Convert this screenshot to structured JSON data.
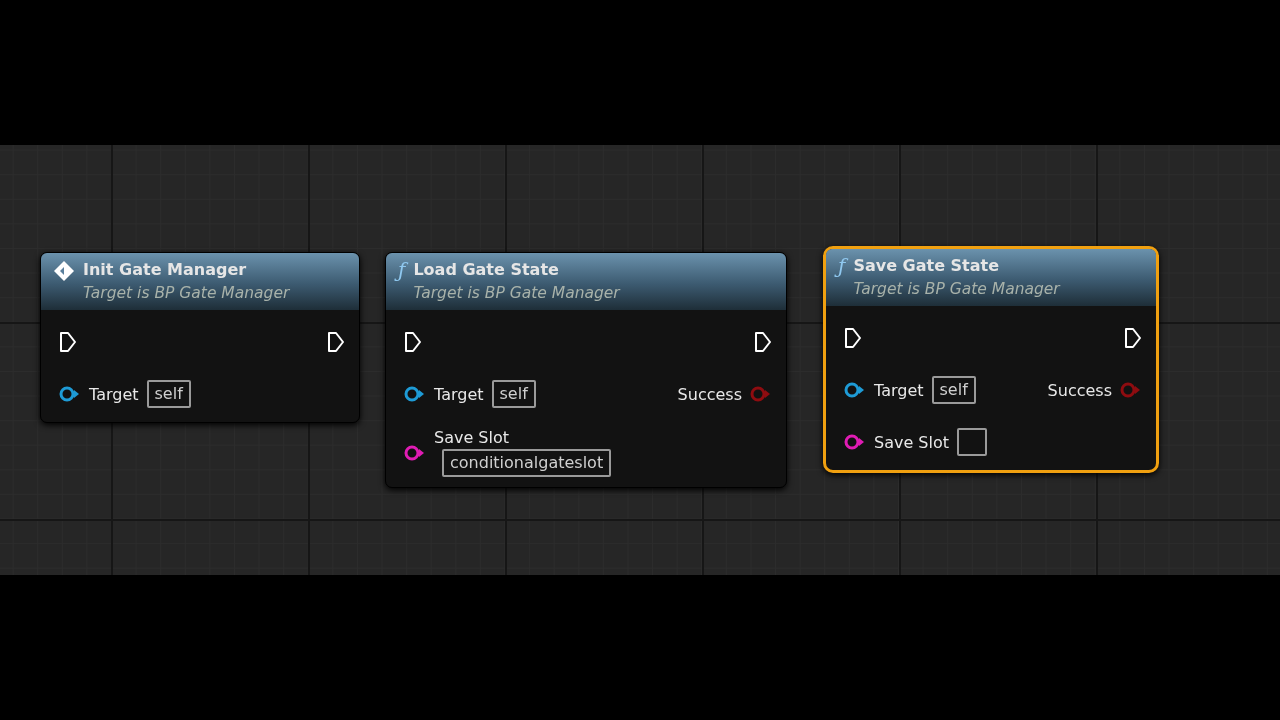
{
  "nodes": [
    {
      "kind": "event",
      "title": "Init Gate Manager",
      "subtitle": "Target is BP Gate Manager",
      "selected": false,
      "inputs": [
        {
          "kind": "exec"
        },
        {
          "kind": "object",
          "label": "Target",
          "field": true,
          "value": "self"
        }
      ],
      "outputs": [
        {
          "kind": "exec"
        }
      ]
    },
    {
      "kind": "function",
      "icon_glyph": "ƒ",
      "title": "Load Gate State",
      "subtitle": "Target is BP Gate Manager",
      "selected": false,
      "inputs": [
        {
          "kind": "exec"
        },
        {
          "kind": "object",
          "label": "Target",
          "field": true,
          "value": "self"
        },
        {
          "kind": "string",
          "label": "Save Slot",
          "field": true,
          "value": "conditionalgateslot",
          "value_below": true
        }
      ],
      "outputs": [
        {
          "kind": "exec"
        },
        {
          "kind": "bool",
          "label": "Success"
        }
      ]
    },
    {
      "kind": "function",
      "icon_glyph": "ƒ",
      "title": "Save Gate State",
      "subtitle": "Target is BP Gate Manager",
      "selected": true,
      "inputs": [
        {
          "kind": "exec"
        },
        {
          "kind": "object",
          "label": "Target",
          "field": true,
          "value": "self"
        },
        {
          "kind": "string",
          "label": "Save Slot",
          "field": true
        }
      ],
      "outputs": [
        {
          "kind": "exec"
        },
        {
          "kind": "bool",
          "label": "Success"
        }
      ]
    }
  ]
}
